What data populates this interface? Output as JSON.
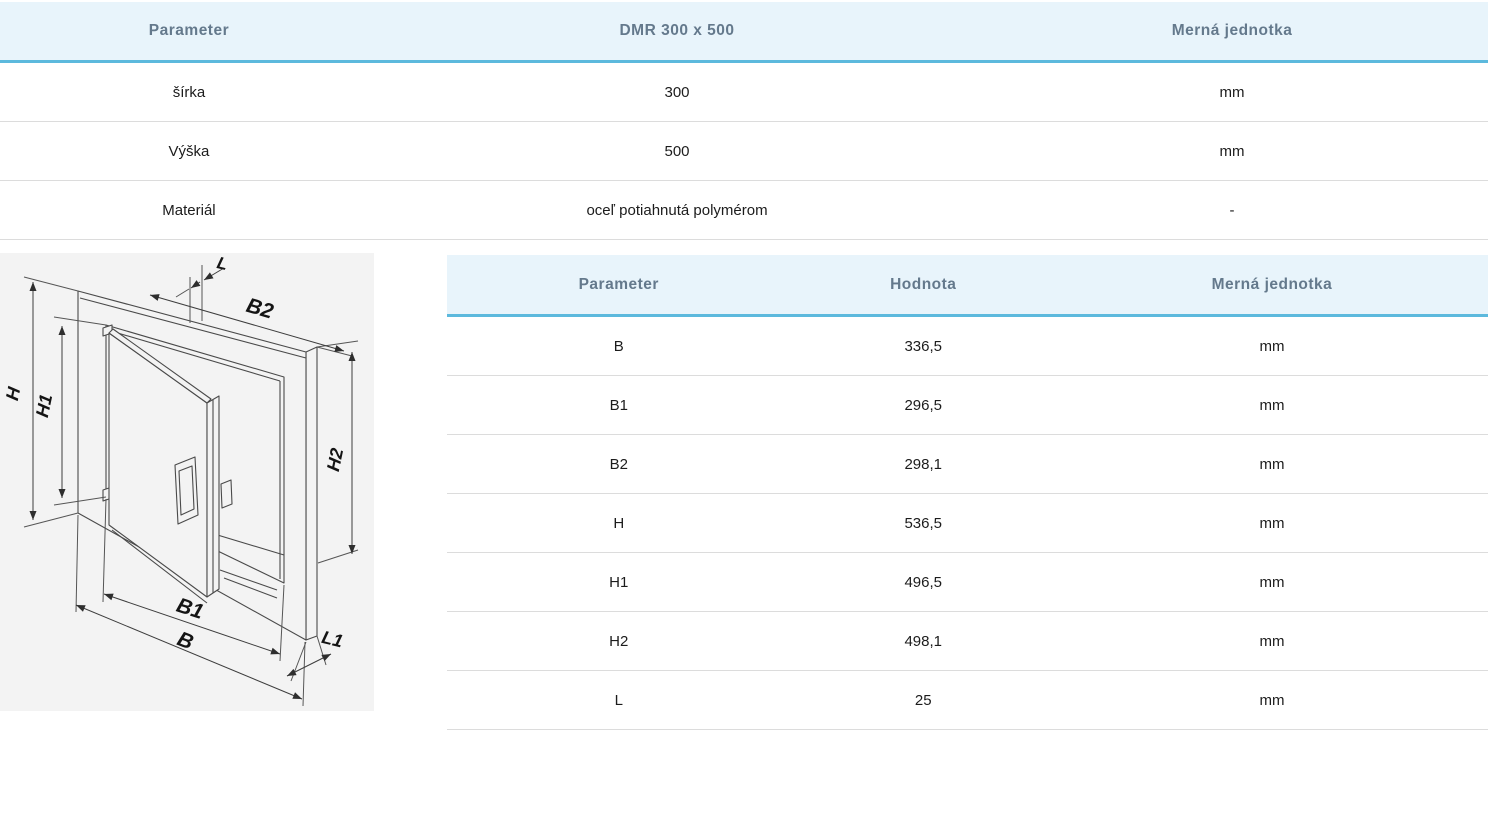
{
  "colors": {
    "header_bg": "#e8f4fb",
    "header_border": "#5cb9dd",
    "header_text": "#64798c",
    "row_separator": "#dcdcdc",
    "body_text": "#1c1c1c",
    "diagram_bg": "#f3f3f3"
  },
  "spec_table": {
    "columns": [
      "Parameter",
      "DMR 300 x 500",
      "Merná jednotka"
    ],
    "rows": [
      [
        "šírka",
        "300",
        "mm"
      ],
      [
        "Výška",
        "500",
        "mm"
      ],
      [
        "Materiál",
        "oceľ potiahnutá polymérom",
        "-"
      ]
    ]
  },
  "dimensions_table": {
    "columns": [
      "Parameter",
      "Hodnota",
      "Merná jednotka"
    ],
    "rows": [
      [
        "B",
        "336,5",
        "mm"
      ],
      [
        "B1",
        "296,5",
        "mm"
      ],
      [
        "B2",
        "298,1",
        "mm"
      ],
      [
        "H",
        "536,5",
        "mm"
      ],
      [
        "H1",
        "496,5",
        "mm"
      ],
      [
        "H2",
        "498,1",
        "mm"
      ],
      [
        "L",
        "25",
        "mm"
      ]
    ]
  },
  "diagram": {
    "labels": {
      "h": "H",
      "h1": "H1",
      "h2": "H2",
      "b": "B",
      "b1": "B1",
      "b2": "B2",
      "l": "L",
      "l1": "L1"
    }
  }
}
